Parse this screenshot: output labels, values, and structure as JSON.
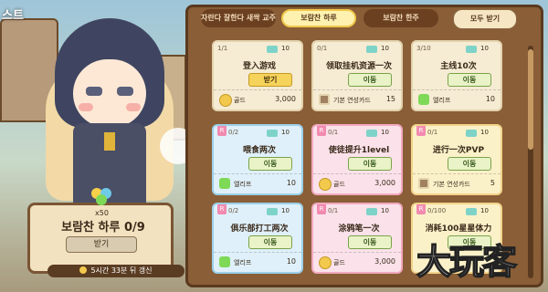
{
  "header": {
    "left_title": "스트"
  },
  "tabs": [
    {
      "label": "자란다 잘한다 새싹 교주"
    },
    {
      "label": "보람찬 하루"
    },
    {
      "label": "보람찬 한주"
    }
  ],
  "receive_all_label": "모두 받기",
  "left_panel": {
    "reward_count": "x50",
    "title": "보람찬 하루 0/9",
    "receive_label": "받기",
    "timer": "5시간 33분 뒤 갱신"
  },
  "cards": [
    {
      "progress": "1/1",
      "tickets": "10",
      "name": "登入游戏",
      "button": "받기",
      "reward_name": "골드",
      "reward_amount": "3,000"
    },
    {
      "progress": "0/1",
      "tickets": "10",
      "name": "领取挂机资源一次",
      "button": "이동",
      "reward_name": "기본 연성카드",
      "reward_amount": "15"
    },
    {
      "progress": "3/10",
      "tickets": "10",
      "name": "主线10次",
      "button": "이동",
      "reward_name": "엘리프",
      "reward_amount": "10"
    },
    {
      "progress": "0/2",
      "tickets": "10",
      "name": "喂食两次",
      "button": "이동",
      "reward_name": "엘리프",
      "reward_amount": "10"
    },
    {
      "progress": "0/1",
      "tickets": "10",
      "name": "使徒提升1level",
      "button": "이동",
      "reward_name": "골드",
      "reward_amount": "3,000"
    },
    {
      "progress": "0/1",
      "tickets": "10",
      "name": "进行一次PVP",
      "button": "이동",
      "reward_name": "기본 연성카드",
      "reward_amount": "5"
    },
    {
      "progress": "0/2",
      "tickets": "10",
      "name": "俱乐部打工两次",
      "button": "이동",
      "reward_name": "엘리프",
      "reward_amount": "10"
    },
    {
      "progress": "0/1",
      "tickets": "10",
      "name": "涂鸦笔一次",
      "button": "이동",
      "reward_name": "골드",
      "reward_amount": "3,000"
    },
    {
      "progress": "0/100",
      "tickets": "10",
      "name": "消耗100星星体力",
      "button": "이동",
      "reward_name": "",
      "reward_amount": ""
    }
  ],
  "watermark": "大玩客",
  "colors": {
    "board": "#8a5e37",
    "tab_active": "#fff2b0",
    "gold": "#f2c94c"
  }
}
